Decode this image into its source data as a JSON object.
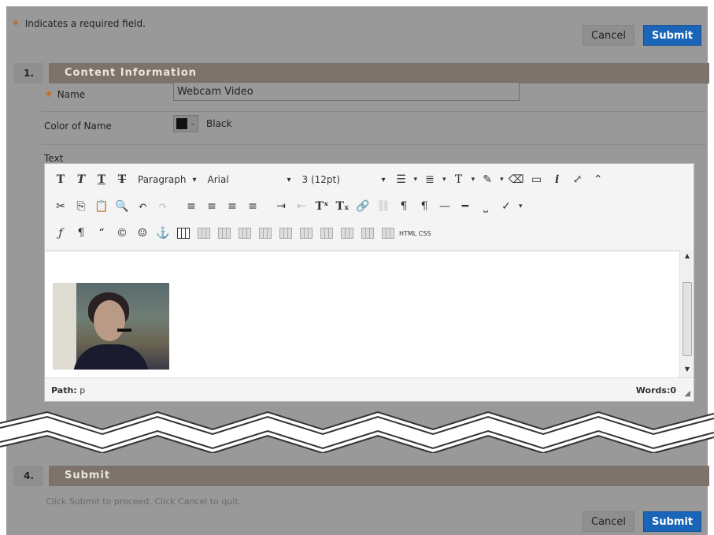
{
  "form": {
    "required_note": "Indicates a required field.",
    "cancel_label": "Cancel",
    "submit_label": "Submit"
  },
  "sections": [
    {
      "number": "1.",
      "title": "Content Information"
    },
    {
      "number": "4.",
      "title": "Submit"
    }
  ],
  "fields": {
    "name_label": "Name",
    "name_value": "Webcam Video",
    "color_label": "Color of Name",
    "color_value": "Black",
    "color_swatch": "#111111",
    "text_label": "Text"
  },
  "editor": {
    "format_select": "Paragraph",
    "font_select": "Arial",
    "size_select": "3 (12pt)",
    "html_css_label": "HTML CSS",
    "path_label": "Path:",
    "path_value": "p",
    "words_label": "Words:",
    "words_value": "0",
    "embedded_image": "webcam-video-thumbnail"
  },
  "submit_section": {
    "instructions": "Click Submit to proceed. Click Cancel to quit."
  },
  "colors": {
    "accent_blue": "#1a65b8",
    "section_header": "#7d736a",
    "required_star": "#c06a1a"
  }
}
